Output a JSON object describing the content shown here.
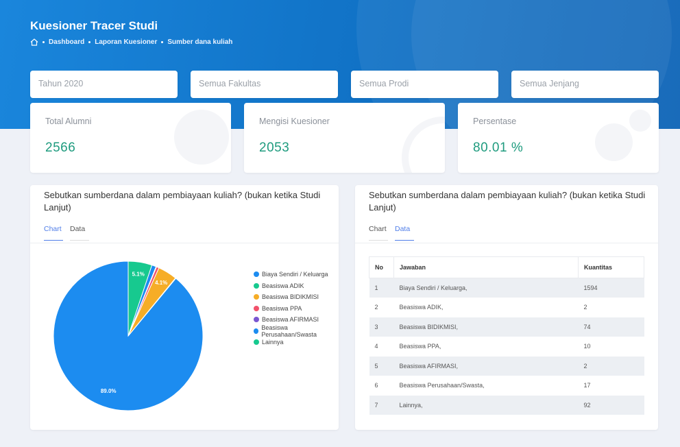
{
  "header": {
    "title": "Kuesioner Tracer Studi",
    "breadcrumb": [
      "Dashboard",
      "Laporan Kuesioner",
      "Sumber dana kuliah"
    ]
  },
  "filters": [
    {
      "value": "Tahun 2020"
    },
    {
      "placeholder": "Semua Fakultas"
    },
    {
      "placeholder": "Semua Prodi"
    },
    {
      "placeholder": "Semua Jenjang"
    }
  ],
  "stats": [
    {
      "label": "Total Alumni",
      "value": "2566"
    },
    {
      "label": "Mengisi Kuesioner",
      "value": "2053"
    },
    {
      "label": "Persentase",
      "value": "80.01 %"
    }
  ],
  "chart_panel": {
    "title": "Sebutkan sumberdana dalam pembiayaan kuliah? (bukan ketika Studi Lanjut)",
    "tabs": [
      "Chart",
      "Data"
    ],
    "active_tab": "Chart"
  },
  "data_panel": {
    "title": "Sebutkan sumberdana dalam pembiayaan kuliah? (bukan ketika Studi Lanjut)",
    "tabs": [
      "Chart",
      "Data"
    ],
    "active_tab": "Data",
    "columns": [
      "No",
      "Jawaban",
      "Kuantitas"
    ],
    "rows": [
      [
        "1",
        "Biaya Sendiri / Keluarga,",
        "1594"
      ],
      [
        "2",
        "Beasiswa ADIK,",
        "2"
      ],
      [
        "3",
        "Beasiswa BIDIKMISI,",
        "74"
      ],
      [
        "4",
        "Beasiswa PPA,",
        "10"
      ],
      [
        "5",
        "Beasiswa AFIRMASI,",
        "2"
      ],
      [
        "6",
        "Beasiswa Perusahaan/Swasta,",
        "17"
      ],
      [
        "7",
        "Lainnya,",
        "92"
      ]
    ]
  },
  "chart_data": {
    "type": "pie",
    "categories": [
      "Biaya Sendiri / Keluarga",
      "Beasiswa ADIK",
      "Beasiswa BIDIKMISI",
      "Beasiswa PPA",
      "Beasiswa AFIRMASI",
      "Beasiswa Perusahaan/Swasta",
      "Lainnya"
    ],
    "values": [
      1594,
      2,
      74,
      10,
      2,
      17,
      92
    ],
    "colors": [
      "#1c8cf0",
      "#17c98f",
      "#f6ad27",
      "#f2526b",
      "#7a57d1",
      "#1c8cf0",
      "#17c98f"
    ],
    "data_labels": [
      "89.0%",
      "",
      "4.1%",
      "",
      "",
      "",
      "5.1%"
    ],
    "legend_position": "right"
  }
}
